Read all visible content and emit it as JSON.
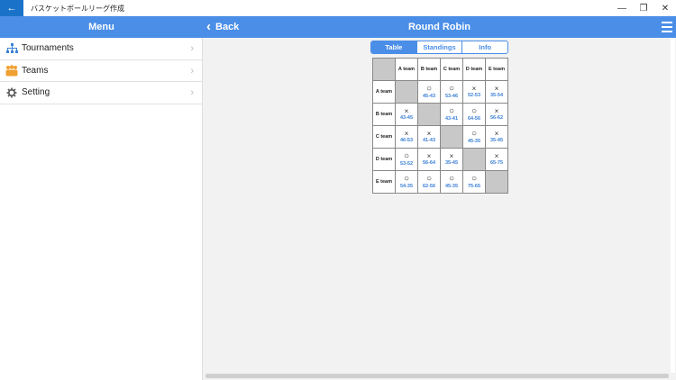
{
  "titlebar": {
    "back_icon": "←",
    "title": "バスケットボールリーグ作成",
    "minimize": "—",
    "maximize": "❐",
    "close": "✕"
  },
  "header": {
    "menu_title": "Menu",
    "back_label": "Back",
    "back_icon": "‹",
    "page_title": "Round Robin"
  },
  "sidebar": {
    "items": [
      {
        "label": "Tournaments",
        "icon": "bracket-icon"
      },
      {
        "label": "Teams",
        "icon": "team-icon"
      },
      {
        "label": "Setting",
        "icon": "gear-icon"
      }
    ],
    "chevron": "›"
  },
  "segments": {
    "tabs": [
      "Table",
      "Standings",
      "Info"
    ],
    "active": "Table"
  },
  "table": {
    "teams": [
      "A team",
      "B team",
      "C team",
      "D team",
      "E team"
    ],
    "win_mark": "○",
    "loss_mark": "×",
    "rows": [
      [
        null,
        {
          "mark": "○",
          "score": "45-43"
        },
        {
          "mark": "○",
          "score": "53-46"
        },
        {
          "mark": "×",
          "score": "52-53"
        },
        {
          "mark": "×",
          "score": "35-54"
        }
      ],
      [
        {
          "mark": "×",
          "score": "43-45"
        },
        null,
        {
          "mark": "○",
          "score": "43-41"
        },
        {
          "mark": "○",
          "score": "64-56"
        },
        {
          "mark": "×",
          "score": "56-62"
        }
      ],
      [
        {
          "mark": "×",
          "score": "46-53"
        },
        {
          "mark": "×",
          "score": "41-43"
        },
        null,
        {
          "mark": "○",
          "score": "45-35"
        },
        {
          "mark": "×",
          "score": "35-45"
        }
      ],
      [
        {
          "mark": "○",
          "score": "53-52"
        },
        {
          "mark": "×",
          "score": "56-64"
        },
        {
          "mark": "×",
          "score": "35-45"
        },
        null,
        {
          "mark": "×",
          "score": "65-75"
        }
      ],
      [
        {
          "mark": "○",
          "score": "54-35"
        },
        {
          "mark": "○",
          "score": "62-56"
        },
        {
          "mark": "○",
          "score": "45-35"
        },
        {
          "mark": "○",
          "score": "75-65"
        },
        null
      ]
    ]
  },
  "colors": {
    "accent": "#4a8ee8",
    "titlebar_back": "#1a73c9",
    "score_text": "#3a7fd5",
    "self_cell": "#c8c8c8"
  }
}
